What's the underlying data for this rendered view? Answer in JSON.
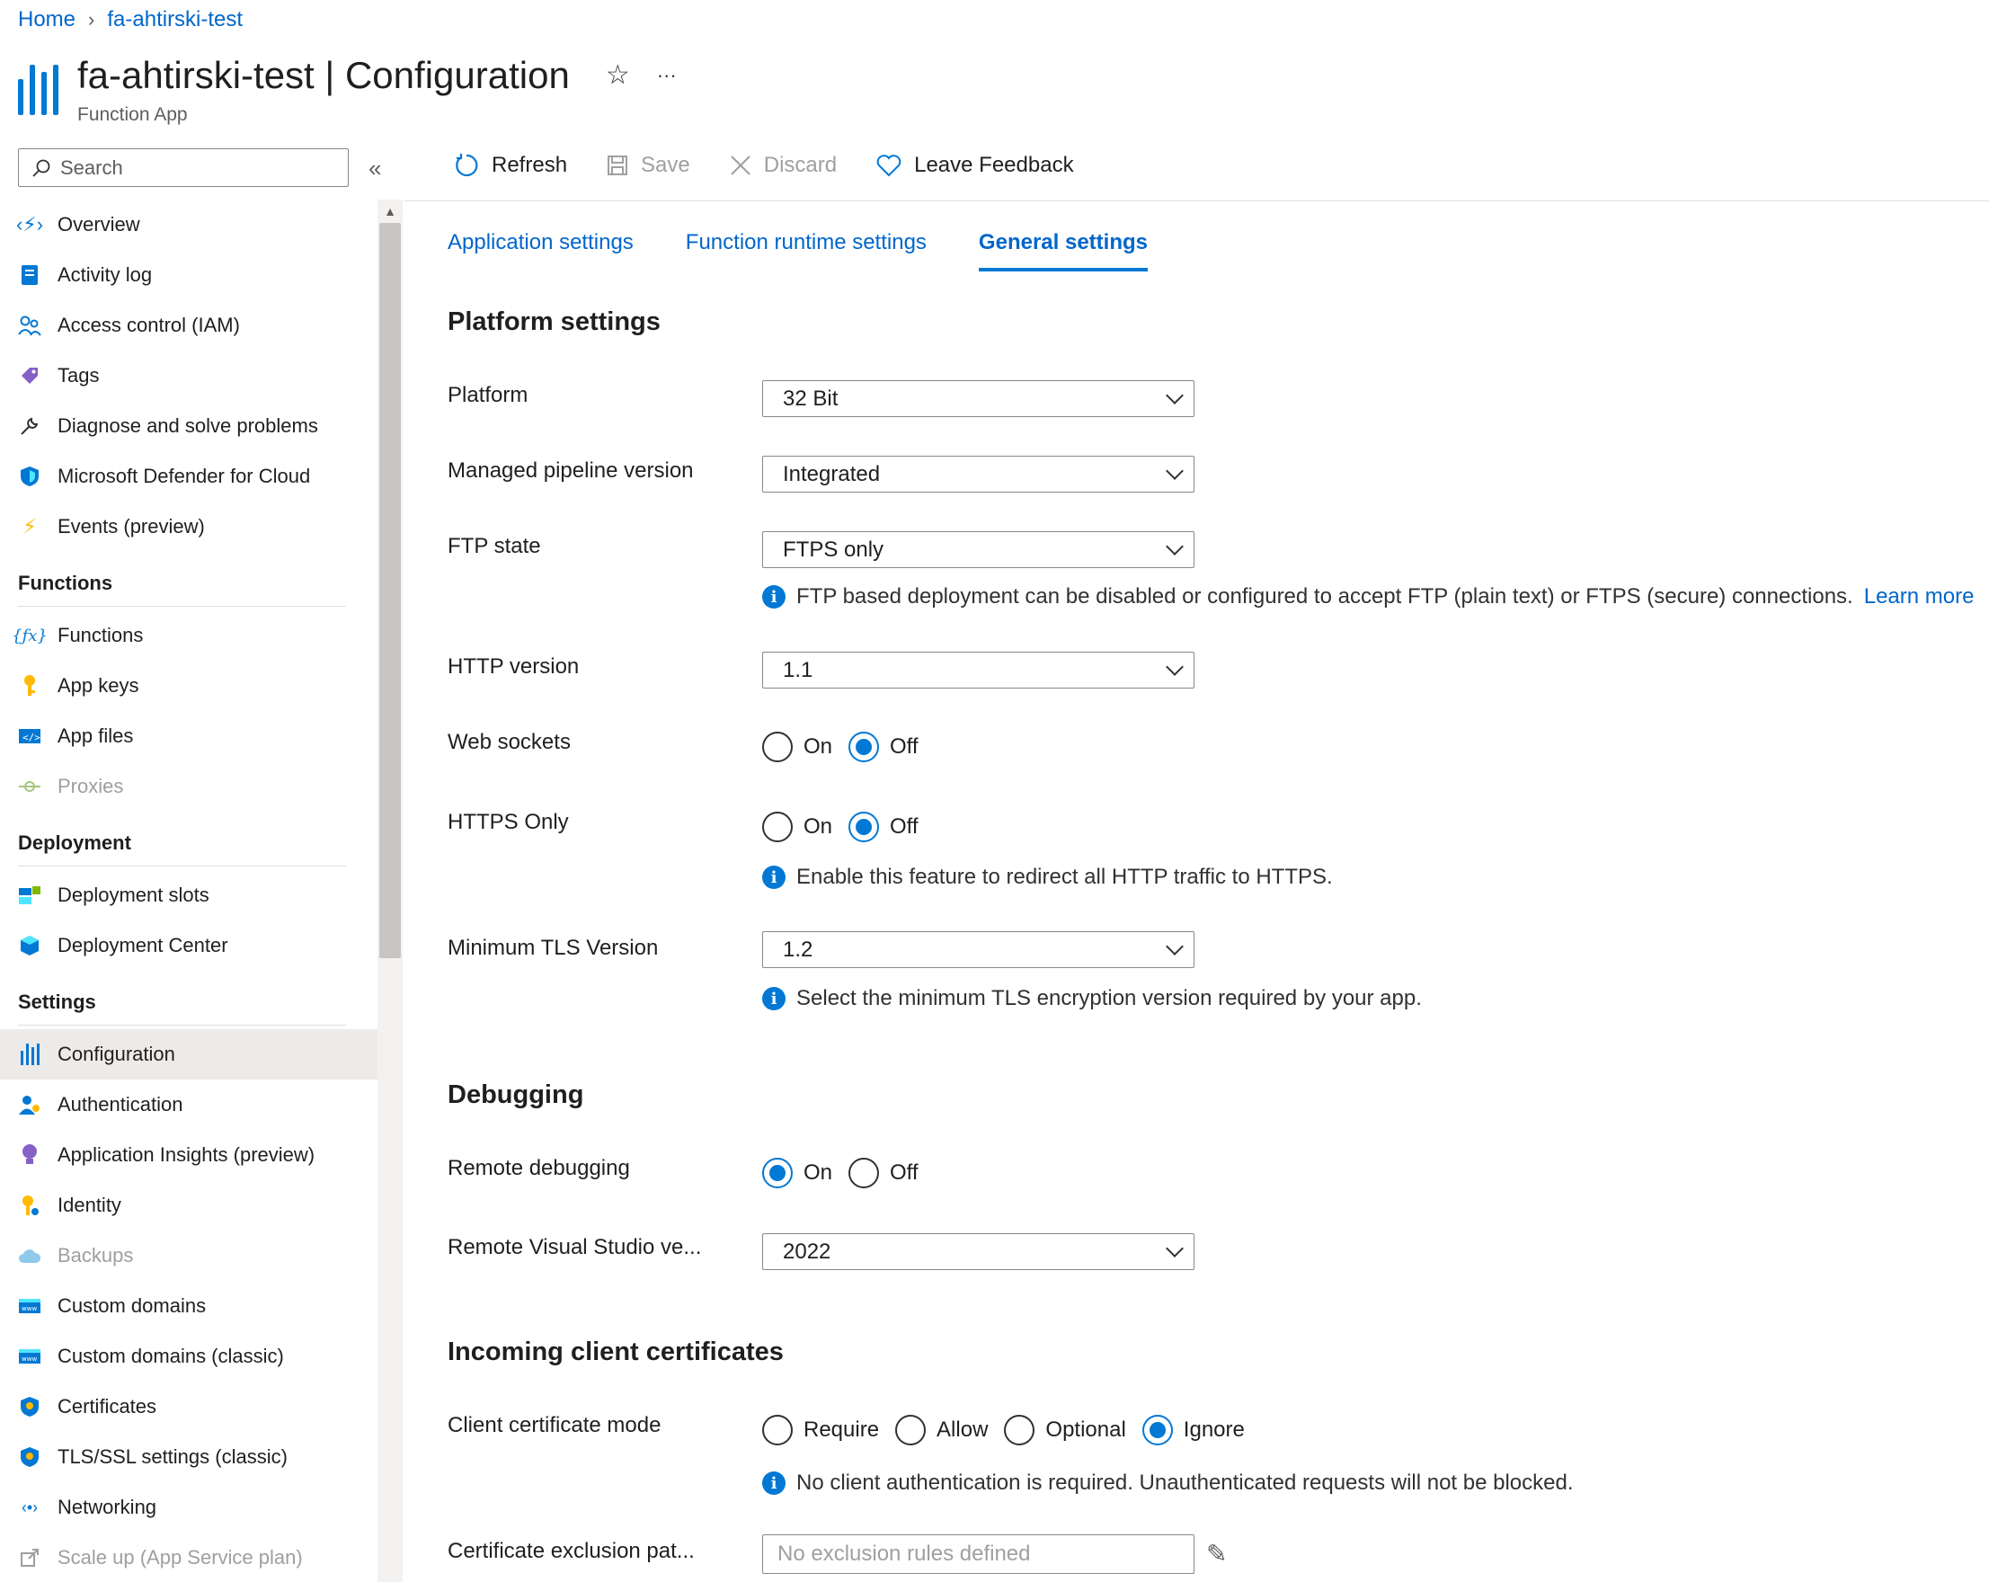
{
  "breadcrumb": {
    "home": "Home",
    "separator": "›",
    "current": "fa-ahtirski-test"
  },
  "header": {
    "title": "fa-ahtirski-test | Configuration",
    "subtitle": "Function App",
    "favorite_icon": "☆",
    "more_icon": "···"
  },
  "search": {
    "placeholder": "Search",
    "collapse": "«"
  },
  "sidebar": {
    "top_items": [
      {
        "label": "Overview",
        "icon": "function-app-icon"
      },
      {
        "label": "Activity log",
        "icon": "log-icon"
      },
      {
        "label": "Access control (IAM)",
        "icon": "people-icon"
      },
      {
        "label": "Tags",
        "icon": "tag-icon"
      },
      {
        "label": "Diagnose and solve problems",
        "icon": "wrench-icon"
      },
      {
        "label": "Microsoft Defender for Cloud",
        "icon": "shield-icon"
      },
      {
        "label": "Events (preview)",
        "icon": "bolt-icon"
      }
    ],
    "functions_header": "Functions",
    "functions_items": [
      {
        "label": "Functions",
        "icon": "fx-icon"
      },
      {
        "label": "App keys",
        "icon": "key-icon"
      },
      {
        "label": "App files",
        "icon": "code-file-icon"
      },
      {
        "label": "Proxies",
        "icon": "proxy-icon",
        "disabled": true
      }
    ],
    "deployment_header": "Deployment",
    "deployment_items": [
      {
        "label": "Deployment slots",
        "icon": "slots-icon"
      },
      {
        "label": "Deployment Center",
        "icon": "cube-icon"
      }
    ],
    "settings_header": "Settings",
    "settings_items": [
      {
        "label": "Configuration",
        "icon": "configuration-icon",
        "selected": true
      },
      {
        "label": "Authentication",
        "icon": "user-auth-icon"
      },
      {
        "label": "Application Insights (preview)",
        "icon": "bulb-icon"
      },
      {
        "label": "Identity",
        "icon": "identity-key-icon"
      },
      {
        "label": "Backups",
        "icon": "cloud-icon",
        "disabled": true
      },
      {
        "label": "Custom domains",
        "icon": "www-icon"
      },
      {
        "label": "Custom domains (classic)",
        "icon": "www-icon"
      },
      {
        "label": "Certificates",
        "icon": "certificate-shield-icon"
      },
      {
        "label": "TLS/SSL settings (classic)",
        "icon": "tls-shield-icon"
      },
      {
        "label": "Networking",
        "icon": "network-icon"
      },
      {
        "label": "Scale up (App Service plan)",
        "icon": "scale-up-icon",
        "disabled": true
      }
    ]
  },
  "toolbar": {
    "refresh": "Refresh",
    "save": "Save",
    "discard": "Discard",
    "feedback": "Leave Feedback"
  },
  "tabs": [
    "Application settings",
    "Function runtime settings",
    "General settings"
  ],
  "platform": {
    "heading": "Platform settings",
    "platform_label": "Platform",
    "platform_value": "32 Bit",
    "pipeline_label": "Managed pipeline version",
    "pipeline_value": "Integrated",
    "ftp_label": "FTP state",
    "ftp_value": "FTPS only",
    "ftp_info": "FTP based deployment can be disabled or configured to accept FTP (plain text) or FTPS (secure) connections.",
    "ftp_learn_more": "Learn more",
    "http_label": "HTTP version",
    "http_value": "1.1",
    "websockets_label": "Web sockets",
    "https_label": "HTTPS Only",
    "https_info": "Enable this feature to redirect all HTTP traffic to HTTPS.",
    "tls_label": "Minimum TLS Version",
    "tls_value": "1.2",
    "tls_info": "Select the minimum TLS encryption version required by your app."
  },
  "radio_labels": {
    "on": "On",
    "off": "Off"
  },
  "debugging": {
    "heading": "Debugging",
    "remote_label": "Remote debugging",
    "vs_label": "Remote Visual Studio ve...",
    "vs_value": "2022"
  },
  "certs": {
    "heading": "Incoming client certificates",
    "mode_label": "Client certificate mode",
    "options": [
      "Require",
      "Allow",
      "Optional",
      "Ignore"
    ],
    "selected": "Ignore",
    "mode_info": "No client authentication is required. Unauthenticated requests will not be blocked.",
    "exclusion_label": "Certificate exclusion pat...",
    "exclusion_placeholder": "No exclusion rules defined"
  },
  "state": {
    "web_sockets": "Off",
    "https_only": "Off",
    "remote_debugging": "On"
  },
  "colors": {
    "accent": "#0078d4",
    "link": "#0066cc",
    "selected_bg": "#edebe9"
  }
}
